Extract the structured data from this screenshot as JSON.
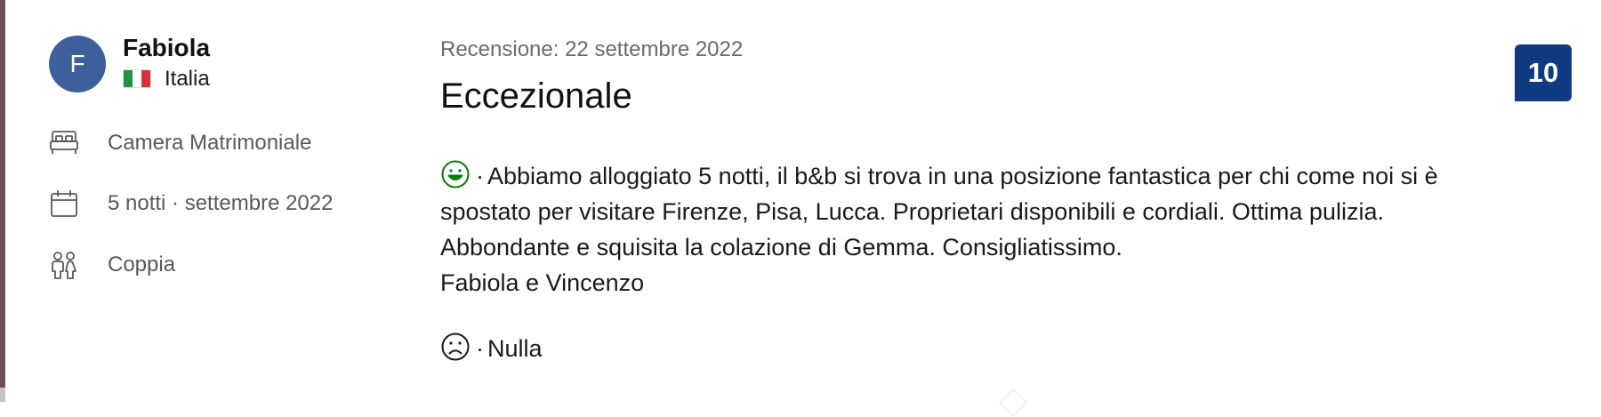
{
  "reviewer": {
    "initial": "F",
    "name": "Fabiola",
    "country": "Italia"
  },
  "details": {
    "room": "Camera Matrimoniale",
    "stay": "5 notti · settembre 2022",
    "traveler_type": "Coppia"
  },
  "review": {
    "date_label": "Recensione: 22 settembre 2022",
    "title": "Eccezionale",
    "score": "10",
    "positive_lines": [
      "Abbiamo alloggiato 5 notti, il b&b si trova in una posizione fantastica per chi come noi si è",
      "spostato per visitare Firenze, Pisa, Lucca. Proprietari disponibili e cordiali. Ottima pulizia.",
      "Abbondante e squisita la colazione di Gemma. Consigliatissimo.",
      "Fabiola e Vincenzo"
    ],
    "negative": "Nulla",
    "separator": "·"
  },
  "colors": {
    "avatar": "#3d5f9c",
    "score_badge": "#0e3a82",
    "positive_icon": "#008009",
    "negative_icon": "#1a1a1a"
  },
  "icons": {
    "room": "bed-icon",
    "stay": "calendar-icon",
    "traveler": "couple-icon",
    "positive": "smiley-happy-icon",
    "negative": "smiley-sad-icon",
    "flag": "italy-flag-icon"
  }
}
